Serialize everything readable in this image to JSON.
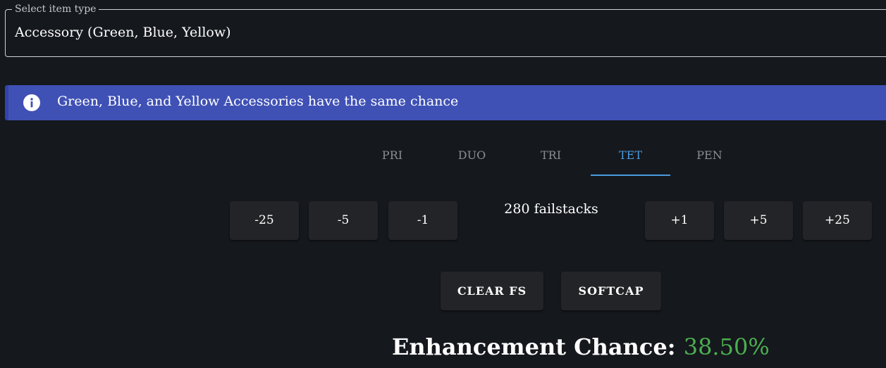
{
  "select": {
    "label": "Select item type",
    "value": "Accessory (Green, Blue, Yellow)"
  },
  "alert": {
    "icon": "info-icon",
    "text": "Green, Blue, and Yellow Accessories have the same chance",
    "color": "#3f51b5"
  },
  "tabs": [
    {
      "label": "PRI",
      "active": false
    },
    {
      "label": "DUO",
      "active": false
    },
    {
      "label": "TRI",
      "active": false
    },
    {
      "label": "TET",
      "active": true
    },
    {
      "label": "PEN",
      "active": false
    }
  ],
  "failstack": {
    "decrement_buttons": [
      "-25",
      "-5",
      "-1"
    ],
    "increment_buttons": [
      "+1",
      "+5",
      "+25"
    ],
    "text": "280 failstacks"
  },
  "actions": {
    "clear_label": "CLEAR FS",
    "softcap_label": "SOFTCAP"
  },
  "result": {
    "label": "Enhancement Chance:",
    "value": "38.50%",
    "value_color": "#4caf50"
  },
  "colors": {
    "background": "#15181d",
    "accent": "#4a9be0",
    "button": "#232427"
  }
}
